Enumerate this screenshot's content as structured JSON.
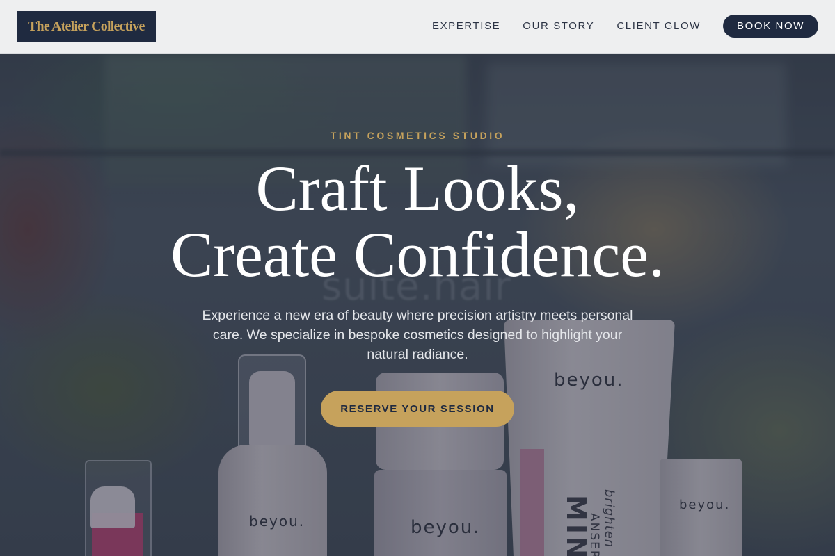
{
  "header": {
    "logo_text": "The Atelier Collective",
    "nav": [
      {
        "label": "EXPERTISE"
      },
      {
        "label": "OUR STORY"
      },
      {
        "label": "CLIENT GLOW"
      }
    ],
    "cta_label": "BOOK NOW"
  },
  "hero": {
    "eyebrow": "TINT COSMETICS STUDIO",
    "headline_line1": "Craft Looks,",
    "headline_line2": "Create Confidence.",
    "description": "Experience a new era of beauty where precision artistry meets personal care. We specialize in bespoke cosmetics designed to highlight your natural radiance.",
    "cta_label": "RESERVE YOUR SESSION"
  },
  "background_photo": {
    "sign_text": "suite.hair",
    "product_brand": "beyou.",
    "tube_text_1": "MINC",
    "tube_text_2": "ANSER",
    "tube_text_3": "brighten"
  },
  "colors": {
    "navy": "#1f2a40",
    "gold": "#c6a25c",
    "header_bg": "#eeeff0",
    "white": "#ffffff"
  }
}
